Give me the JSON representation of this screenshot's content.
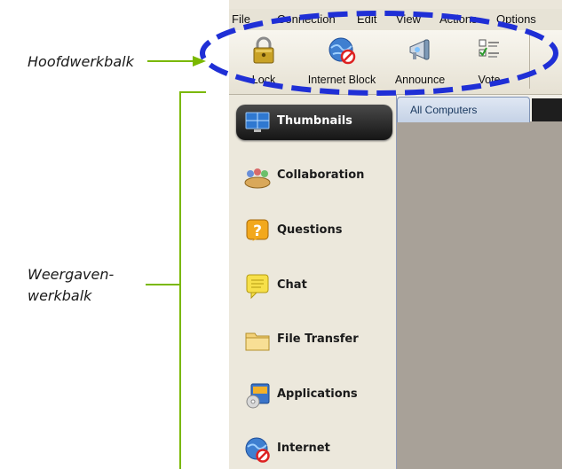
{
  "callouts": {
    "main_toolbar": "Hoofdwerkbalk",
    "views_toolbar_line1": "Weergaven-",
    "views_toolbar_line2": "werkbalk"
  },
  "menu": {
    "file": "File",
    "connection": "Connection",
    "edit": "Edit",
    "view": "View",
    "actions": "Actions",
    "options": "Options"
  },
  "toolbar": {
    "lock": "Lock",
    "internet_block": "Internet Block",
    "announce": "Announce",
    "vote": "Vote"
  },
  "sidebar": {
    "items": [
      {
        "label": "Thumbnails",
        "icon": "thumbnails-icon",
        "active": true
      },
      {
        "label": "Collaboration",
        "icon": "collaboration-icon"
      },
      {
        "label": "Questions",
        "icon": "questions-icon"
      },
      {
        "label": "Chat",
        "icon": "chat-icon"
      },
      {
        "label": "File Transfer",
        "icon": "folder-icon"
      },
      {
        "label": "Applications",
        "icon": "applications-icon"
      },
      {
        "label": "Internet",
        "icon": "internet-icon"
      }
    ]
  },
  "tabs": {
    "all_computers": "All Computers"
  },
  "colors": {
    "callout_line": "#7ab800",
    "highlight_dash": "#1f2fd6"
  }
}
